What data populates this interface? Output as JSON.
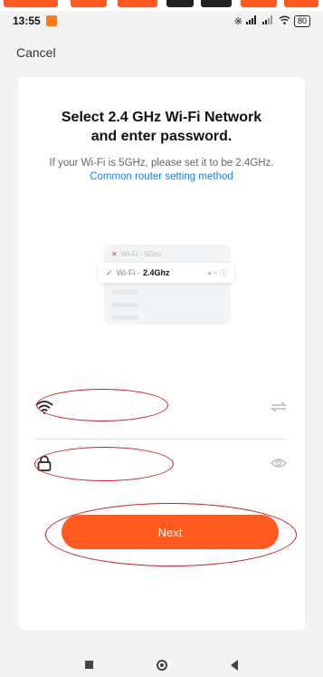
{
  "status_bar": {
    "time": "13:55",
    "battery": "80"
  },
  "header": {
    "cancel_label": "Cancel"
  },
  "main": {
    "title_line1": "Select 2.4 GHz Wi-Fi Network",
    "title_line2": "and enter password.",
    "subtitle": "If your Wi-Fi is 5GHz, please set it to be 2.4GHz.",
    "subtitle_link": "Common router setting method"
  },
  "illustration": {
    "wifi_5g_prefix": "Wi-Fi - ",
    "wifi_5g_band": "5Ghz",
    "wifi_24_prefix": "Wi-Fi - ",
    "wifi_24_band": "2.4Ghz"
  },
  "form": {
    "wifi_name_value": "",
    "password_value": "",
    "next_label": "Next"
  },
  "colors": {
    "accent": "#ff5a1f",
    "link": "#1e7fd8",
    "annotation": "#c81e2a"
  }
}
